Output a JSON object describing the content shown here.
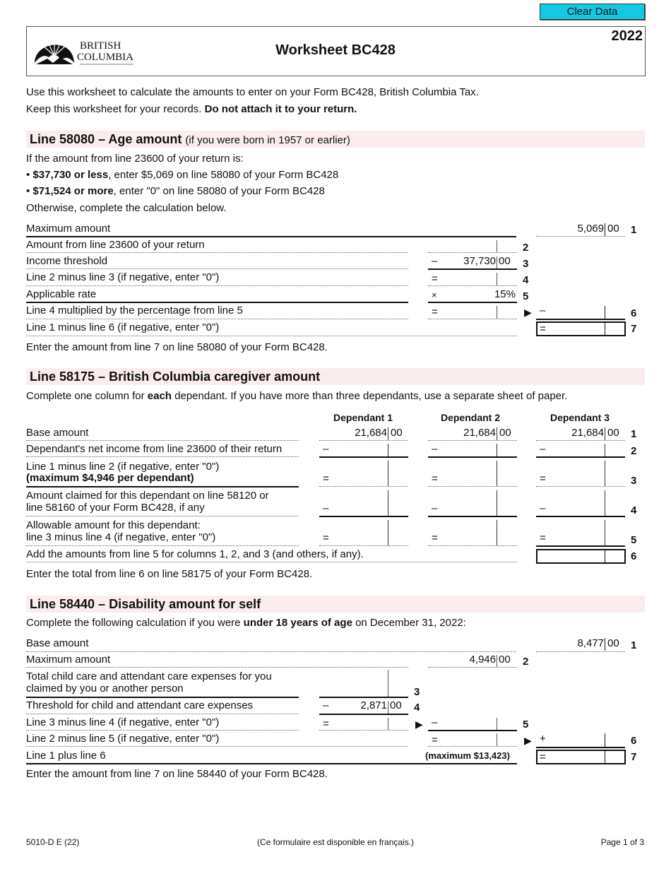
{
  "toolbar": {
    "clear_label": "Clear Data"
  },
  "header": {
    "logo_line1": "BRITISH",
    "logo_line2": "COLUMBIA",
    "title": "Worksheet BC428",
    "year": "2022"
  },
  "intro": {
    "line1": "Use this worksheet to calculate the amounts to enter on your Form BC428, British Columbia Tax.",
    "line2_plain": "Keep this worksheet for your records. ",
    "line2_bold": "Do not attach it to your return."
  },
  "age": {
    "title": "Line 58080 – Age amount",
    "subtitle": "(if you were born in 1957 or earlier)",
    "lead": "If the amount from line 23600 of your return is:",
    "bullet1_bold": "$37,730 or less",
    "bullet1_rest": ", enter $5,069 on line 58080 of your Form BC428",
    "bullet2_bold": "$71,524 or more",
    "bullet2_rest": ", enter \"0\" on line 58080 of your Form BC428",
    "otherwise": "Otherwise, complete the calculation below.",
    "rows": [
      {
        "label": "Maximum amount",
        "line": "1",
        "dollars": "5,069",
        "cents": "00"
      },
      {
        "label": "Amount from line 23600 of your return",
        "line": "2"
      },
      {
        "label": "Income threshold",
        "line": "3",
        "op": "–",
        "dollars": "37,730",
        "cents": "00"
      },
      {
        "label": "Line 2 minus line 3 (if negative, enter \"0\")",
        "line": "4",
        "op": "="
      },
      {
        "label": "Applicable rate",
        "line": "5",
        "op": "×",
        "value": "15%"
      },
      {
        "label": "Line 4 multiplied by the percentage from line 5",
        "line": "6",
        "op": "=",
        "op2": "–"
      },
      {
        "label": "Line 1 minus line 6 (if negative, enter \"0\")",
        "line": "7",
        "op": "="
      }
    ],
    "footer": "Enter the amount from line 7 on line 58080 of your Form BC428."
  },
  "caregiver": {
    "title": "Line 58175 – British Columbia caregiver amount",
    "lead_plain1": "Complete one column for ",
    "lead_bold": "each",
    "lead_plain2": " dependant. If you have more than three dependants, use a separate sheet of paper.",
    "columns": [
      "Dependant 1",
      "Dependant 2",
      "Dependant 3"
    ],
    "rows": [
      {
        "label": "Base amount",
        "line": "1",
        "dollars": "21,684",
        "cents": "00"
      },
      {
        "label": "Dependant's net income from line 23600 of their return",
        "line": "2",
        "op": "–"
      },
      {
        "label1": "Line 1 minus line 2 (if negative, enter \"0\")",
        "label2": "(maximum $4,946 per dependant)",
        "line": "3",
        "op": "="
      },
      {
        "label1": "Amount claimed for this dependant on line 58120 or",
        "label2": "line 58160 of your Form BC428, if any",
        "line": "4",
        "op": "–"
      },
      {
        "label1": "Allowable amount for this dependant:",
        "label2": "line 3 minus line 4 (if negative, enter \"0\")",
        "line": "5",
        "op": "="
      },
      {
        "label": "Add the amounts from line 5 for columns 1, 2, and 3 (and others, if any).",
        "line": "6"
      }
    ],
    "footer": "Enter the total from line 6 on line 58175 of your Form BC428."
  },
  "disability": {
    "title": "Line 58440 – Disability amount for self",
    "lead_plain1": "Complete the following calculation if you were ",
    "lead_bold": "under 18 years of age",
    "lead_plain2": " on December 31, 2022:",
    "rows": [
      {
        "label": "Base amount",
        "line": "1",
        "dollars": "8,477",
        "cents": "00"
      },
      {
        "label": "Maximum amount",
        "line": "2",
        "dollars": "4,946",
        "cents": "00"
      },
      {
        "label1": "Total child care and attendant care expenses for you",
        "label2": "claimed by you or another person",
        "line": "3"
      },
      {
        "label": "Threshold for child and attendant care expenses",
        "line": "4",
        "op": "–",
        "dollars": "2,871",
        "cents": "00"
      },
      {
        "label": "Line 3 minus line 4 (if negative, enter \"0\")",
        "line": "5",
        "op": "=",
        "op2": "–"
      },
      {
        "label": "Line 2 minus line 5 (if negative, enter \"0\")",
        "line": "6",
        "op": "=",
        "op2": "+"
      },
      {
        "label": "Line 1 plus line 6",
        "line": "7",
        "note": "(maximum $13,423)",
        "op": "="
      }
    ],
    "footer": "Enter the amount from line 7 on line 58440 of your Form BC428."
  },
  "page_footer": {
    "form_code": "5010-D E (22)",
    "french_note": "(Ce formulaire est disponible en français.)",
    "page": "Page 1 of 3"
  }
}
